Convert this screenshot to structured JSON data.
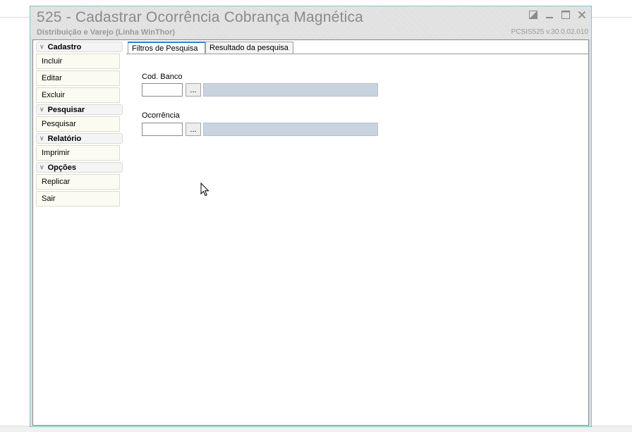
{
  "window": {
    "title": "525 - Cadastrar Ocorrência Cobrança Magnética",
    "subtitle": "Distribuição e Varejo (Linha WinThor)",
    "version": "PCSIS525  v.30.0.02.010",
    "controls": {
      "restore": "restore-icon",
      "minimize": "minimize-icon",
      "maximize": "maximize-icon",
      "close": "close-icon"
    }
  },
  "sidebar": {
    "groups": [
      {
        "title": "Cadastro",
        "items": [
          "Incluir",
          "Editar",
          "Excluir"
        ]
      },
      {
        "title": "Pesquisar",
        "items": [
          "Pesquisar"
        ]
      },
      {
        "title": "Relatório",
        "items": [
          "Imprimir"
        ]
      },
      {
        "title": "Opções",
        "items": [
          "Replicar",
          "Sair"
        ]
      }
    ]
  },
  "tabs": [
    {
      "label": "Filtros de Pesquisa",
      "active": true
    },
    {
      "label": "Resultado da pesquisa",
      "active": false
    }
  ],
  "filters": {
    "cod_banco": {
      "label": "Cod. Banco",
      "value": "",
      "lookup_button": "...",
      "description": ""
    },
    "ocorrencia": {
      "label": "Ocorrência",
      "value": "",
      "lookup_button": "...",
      "description": ""
    }
  },
  "colors": {
    "window_border": "#7fc6d6",
    "active_tab_accent": "#2b7fd4",
    "description_field": "#c9d3df",
    "nav_button_bg": "#fbfbf2"
  }
}
